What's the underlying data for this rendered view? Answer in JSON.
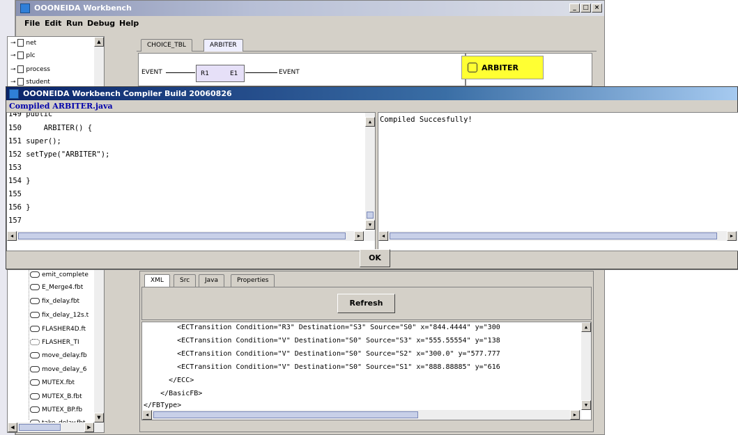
{
  "main_window": {
    "title": "OOONEIDA Workbench",
    "controls": [
      "_",
      "□",
      "×"
    ],
    "menu": [
      "File",
      "Edit",
      "Run",
      "Debug",
      "Help"
    ]
  },
  "tree_top": [
    "net",
    "plc",
    "process",
    "student"
  ],
  "tree_bottom": [
    "emit_complete",
    "E_Merge4.fbt",
    "fix_delay.fbt",
    "fix_delay_12s.t",
    "FLASHER4D.ft",
    "FLASHER_TI",
    "move_delay.fb",
    "move_delay_6",
    "MUTEX.fbt",
    "MUTEX_B.fbt",
    "MUTEX_BP.fb",
    "take_delay.fbt"
  ],
  "editor": {
    "tabs": [
      "CHOICE_TBL",
      "ARBITER"
    ],
    "event_in": "EVENT",
    "event_out": "EVENT",
    "port_in": "R1",
    "port_out": "E1",
    "badge": "ARBITER"
  },
  "dialog": {
    "title": "OOONEIDA Workbench Compiler Build 20060826",
    "subtitle": "Compiled ARBITER.java",
    "code_lines": [
      "149 public",
      "150     ARBITER() {",
      "151 super();",
      "152 setType(\"ARBITER\");",
      "153",
      "154 }",
      "155",
      "156 }",
      "157"
    ],
    "output": "Compiled Succesfully!",
    "ok_label": "OK"
  },
  "lower": {
    "tabs": [
      "XML",
      "Src",
      "Java",
      "Properties"
    ],
    "refresh_label": "Refresh",
    "xml_lines": [
      "        <ECTransition Condition=\"R3\" Destination=\"S3\" Source=\"S0\" x=\"844.4444\" y=\"300",
      "        <ECTransition Condition=\"V\" Destination=\"S0\" Source=\"S3\" x=\"555.55554\" y=\"138",
      "        <ECTransition Condition=\"V\" Destination=\"S0\" Source=\"S2\" x=\"300.0\" y=\"577.777",
      "        <ECTransition Condition=\"V\" Destination=\"S0\" Source=\"S1\" x=\"888.88885\" y=\"616",
      "      </ECC>",
      "    </BasicFB>",
      "</FBType>"
    ]
  }
}
